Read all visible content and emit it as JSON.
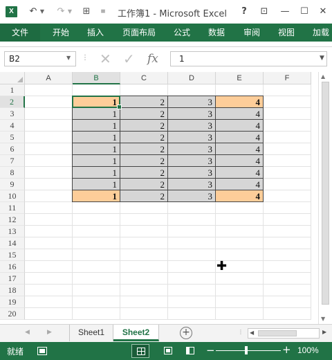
{
  "window": {
    "title": "工作簿1 - Microsoft Excel",
    "logo_text": "X",
    "help_label": "?",
    "ribbon_display_label": "⊡",
    "minimize_label": "—",
    "maximize_label": "☐",
    "close_label": "✕"
  },
  "quick_access": {
    "undo_glyph": "↶",
    "redo_glyph": "↷",
    "dropdown_glyph": "▼",
    "grid_glyph": "⊞",
    "customize_glyph": "≡"
  },
  "ribbon": {
    "tabs": [
      "文件",
      "开始",
      "插入",
      "页面布局",
      "公式",
      "数据",
      "审阅",
      "视图",
      "加载"
    ]
  },
  "formula_bar": {
    "name_box": "B2",
    "name_box_dropdown": "▼",
    "separator": "⋮",
    "cancel_glyph": "✕",
    "enter_glyph": "✓",
    "fx_label": "fx",
    "formula_value": "1",
    "expand_glyph": "▼"
  },
  "grid": {
    "columns": [
      "A",
      "B",
      "C",
      "D",
      "E",
      "F"
    ],
    "selected_column": "B",
    "rows": [
      "1",
      "2",
      "3",
      "4",
      "5",
      "6",
      "7",
      "8",
      "9",
      "10",
      "11",
      "12",
      "13",
      "14",
      "15",
      "16",
      "17",
      "18",
      "19",
      "20"
    ],
    "selected_row": "2",
    "data": [
      {
        "row": "2",
        "B": "1",
        "C": "2",
        "D": "3",
        "E": "4"
      },
      {
        "row": "3",
        "B": "1",
        "C": "2",
        "D": "3",
        "E": "4"
      },
      {
        "row": "4",
        "B": "1",
        "C": "2",
        "D": "3",
        "E": "4"
      },
      {
        "row": "5",
        "B": "1",
        "C": "2",
        "D": "3",
        "E": "4"
      },
      {
        "row": "6",
        "B": "1",
        "C": "2",
        "D": "3",
        "E": "4"
      },
      {
        "row": "7",
        "B": "1",
        "C": "2",
        "D": "3",
        "E": "4"
      },
      {
        "row": "8",
        "B": "1",
        "C": "2",
        "D": "3",
        "E": "4"
      },
      {
        "row": "9",
        "B": "1",
        "C": "2",
        "D": "3",
        "E": "4"
      },
      {
        "row": "10",
        "B": "1",
        "C": "2",
        "D": "3",
        "E": "4"
      }
    ],
    "highlighted_cells": [
      "B2",
      "E2",
      "B10",
      "E10"
    ],
    "cell_fill_gray": "#d6d6d6",
    "cell_fill_orange": "#fdcd99",
    "cursor_glyph": "✚"
  },
  "sheet_tabs": {
    "prev_glyph": "◀",
    "next_glyph": "▶",
    "tabs": [
      "Sheet1",
      "Sheet2"
    ],
    "active": "Sheet2",
    "add_glyph": "+",
    "split_glyph": "⋮"
  },
  "scrollbars": {
    "up_glyph": "▲",
    "down_glyph": "▼",
    "left_glyph": "◀",
    "right_glyph": "▶"
  },
  "status_bar": {
    "ready_text": "就绪",
    "zoom_minus": "−",
    "zoom_plus": "+",
    "zoom_level": "100%"
  },
  "colors": {
    "accent": "#217346",
    "gray_fill": "#d6d6d6",
    "orange_fill": "#fdcd99"
  }
}
